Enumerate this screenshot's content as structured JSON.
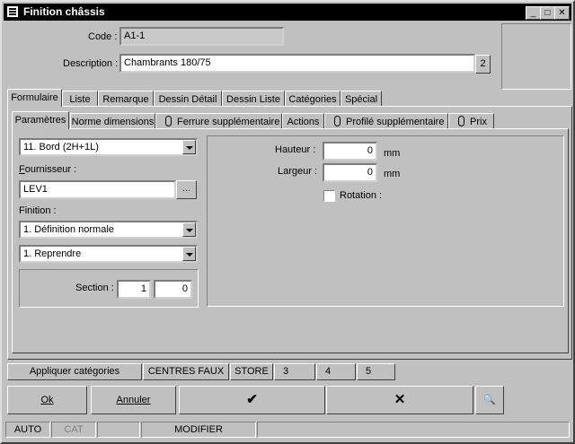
{
  "window": {
    "title": "Finition châssis"
  },
  "titlebar": {
    "minimize": "_",
    "maximize": "□",
    "close": "✕"
  },
  "header": {
    "code_label": "Code :",
    "code_value": "A1-1",
    "description_label": "Description :",
    "description_value": "Chambrants 180/75",
    "description_badge": "2"
  },
  "main_tabs": [
    "Formulaire",
    "Liste",
    "Remarque",
    "Dessin Détail",
    "Dessin Liste",
    "Catégories",
    "Spécial"
  ],
  "sub_tabs": [
    "Paramètres",
    "Norme dimensions",
    "Ferrure supplémentaire",
    "Actions",
    "Profilé supplémentaire",
    "Prix"
  ],
  "params": {
    "bord_value": "11. Bord (2H+1L)",
    "fournisseur_label": "Fournisseur :",
    "fournisseur_value": "LEV1",
    "browse_button": "...",
    "finition_label": "Finition :",
    "finition_value": "1.  Définition normale",
    "reprendre_value": "1.  Reprendre",
    "section_label": "Section :",
    "section_value1": "1",
    "section_value2": "0"
  },
  "dims": {
    "hauteur_label": "Hauteur :",
    "hauteur_value": "0",
    "hauteur_unit": "mm",
    "largeur_label": "Largeur :",
    "largeur_value": "0",
    "largeur_unit": "mm",
    "rotation_label": "Rotation :"
  },
  "category_bar": [
    "Appliquer catégories",
    "CENTRES FAUX",
    "STORE",
    "3",
    "4",
    "5"
  ],
  "actions": {
    "ok": "Ok",
    "annuler": "Annuler",
    "confirm": "✔",
    "cancel": "✕",
    "binoculars": "🔍"
  },
  "status_bar": [
    "AUTO",
    "CAT",
    "",
    "MODIFIER",
    ""
  ]
}
